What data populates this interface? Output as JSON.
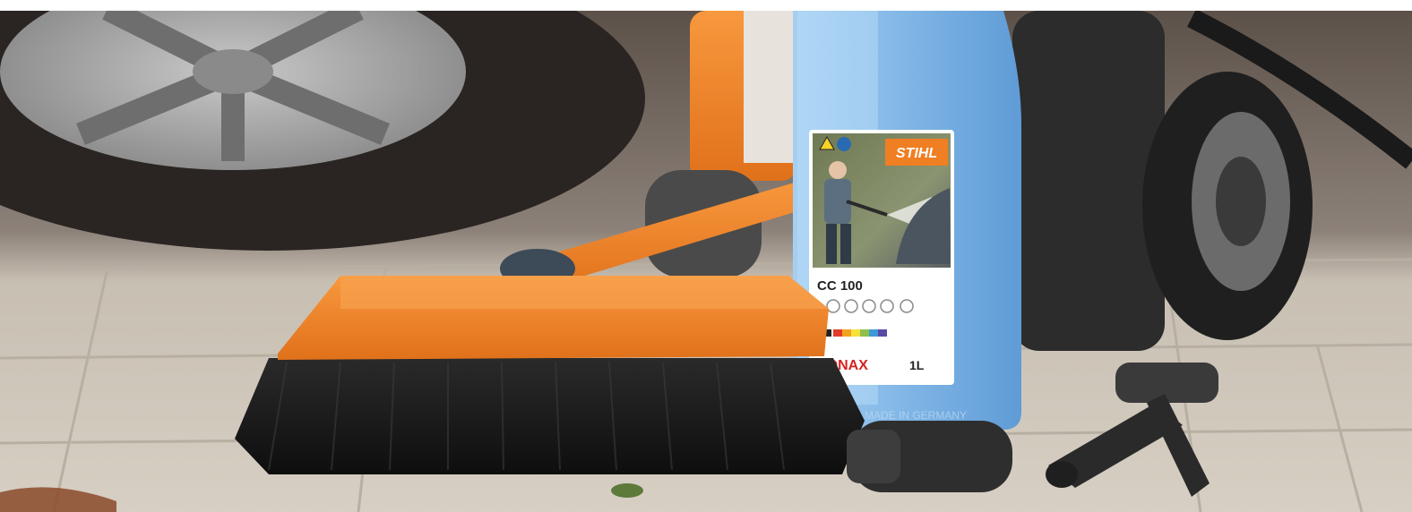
{
  "bottle": {
    "brand_logo": "STIHL",
    "product_name": "CC 100",
    "partner_logo": "SONAX",
    "volume": "1L",
    "embossed_text": "MADE IN GERMANY",
    "bottle_color": "#8fc0ea",
    "liquid_color": "#6ea8df"
  },
  "colors": {
    "stihl_orange": "#f07e22",
    "brush_bristles": "#1c1c1c",
    "paving": "#d3cbbf"
  }
}
